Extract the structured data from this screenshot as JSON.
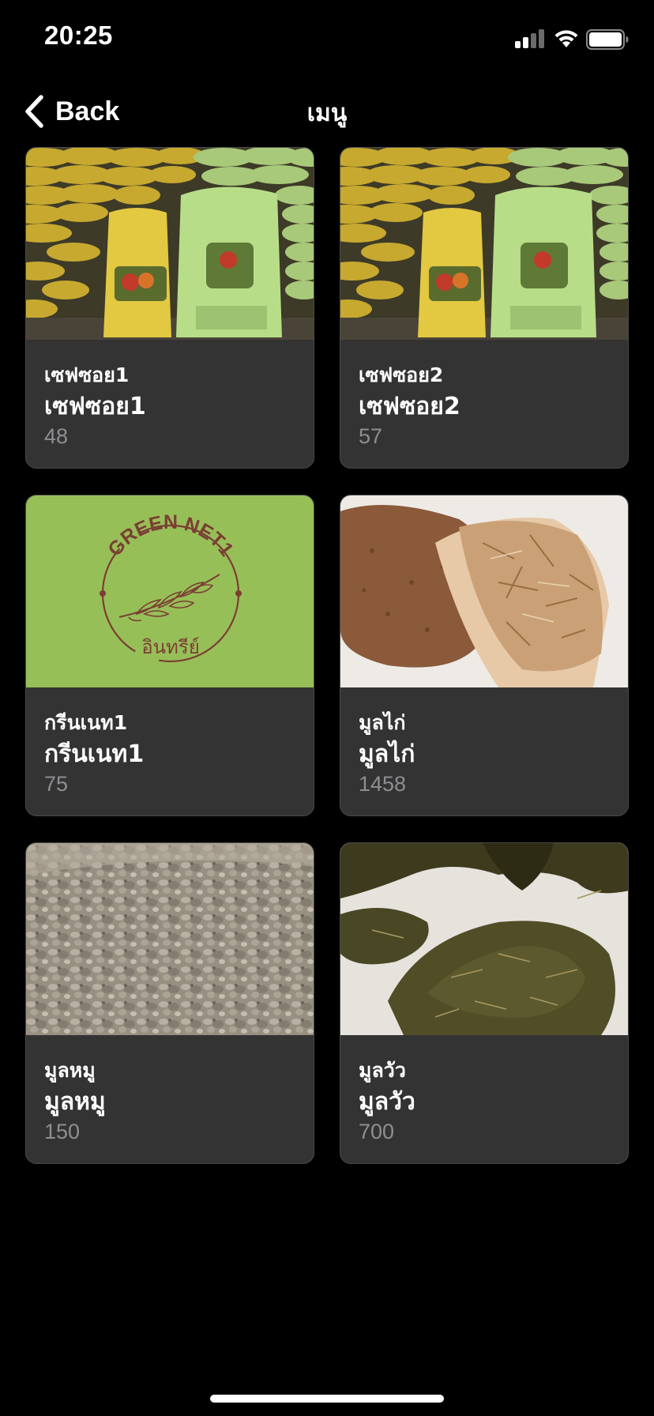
{
  "status_bar": {
    "time": "20:25",
    "icons": [
      "signal-icon",
      "wifi-icon",
      "battery-icon"
    ]
  },
  "nav": {
    "back_label": "Back",
    "title": "เมนู",
    "back_icon": "chevron-left-icon"
  },
  "colors": {
    "background": "#000000",
    "card_background": "#333333",
    "muted_text": "#8e8e93",
    "green_net_bg": "#97bf58",
    "green_net_text": "#7a3f34"
  },
  "products": [
    {
      "subtitle": "เซฟซอย1",
      "title": "เซฟซอย1",
      "count": "48",
      "image": "fertilizer-bags-image"
    },
    {
      "subtitle": "เซฟซอย2",
      "title": "เซฟซอย2",
      "count": "57",
      "image": "fertilizer-bags-image"
    },
    {
      "subtitle": "กรีนเนท1",
      "title": "กรีนเนท1",
      "count": "75",
      "image": "green-net-logo-image",
      "logo": {
        "top_text": "GREEN NET1",
        "bottom_text": "อินทรีย์"
      }
    },
    {
      "subtitle": "มูลไก่",
      "title": "มูลไก่",
      "count": "1458",
      "image": "chicken-manure-image"
    },
    {
      "subtitle": "มูลหมู",
      "title": "มูลหมู",
      "count": "150",
      "image": "pig-manure-image"
    },
    {
      "subtitle": "มูลวัว",
      "title": "มูลวัว",
      "count": "700",
      "image": "cow-manure-image"
    }
  ]
}
